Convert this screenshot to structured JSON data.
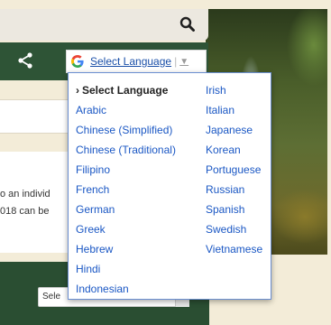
{
  "header": {
    "search_icon": "search-icon"
  },
  "share": {
    "icon": "share-icon"
  },
  "translate": {
    "logo": "google-g-icon",
    "label": "Select Language",
    "separator": "|",
    "arrow": "▼"
  },
  "body": {
    "line1": "o an individ",
    "line2": "018 can be"
  },
  "footer": {
    "select_text": "Sele"
  },
  "languages": {
    "selected": "Select Language",
    "left": [
      "Arabic",
      "Chinese (Simplified)",
      "Chinese (Traditional)",
      "Filipino",
      "French",
      "German",
      "Greek",
      "Hebrew",
      "Hindi",
      "Indonesian"
    ],
    "right": [
      "Irish",
      "Italian",
      "Japanese",
      "Korean",
      "Portuguese",
      "Russian",
      "Spanish",
      "Swedish",
      "Vietnamese"
    ]
  },
  "colors": {
    "page_bg": "#f3ecd8",
    "green_bar": "#2e5436",
    "link_blue": "#1a57c4",
    "menu_border": "#6b8fd1"
  }
}
